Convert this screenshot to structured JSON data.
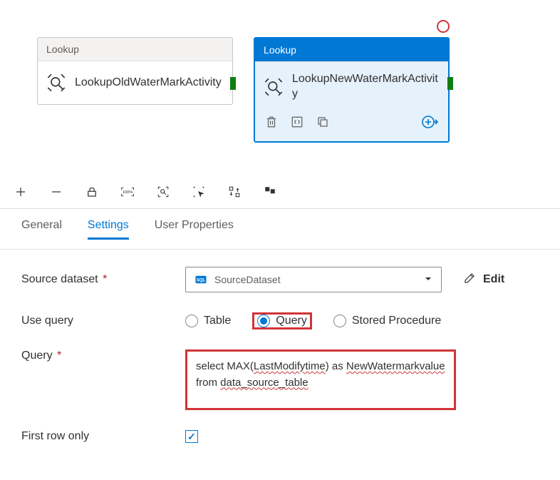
{
  "canvas": {
    "activities": [
      {
        "type_label": "Lookup",
        "name": "LookupOldWaterMarkActivity",
        "selected": false
      },
      {
        "type_label": "Lookup",
        "name": "LookupNewWaterMarkActivity",
        "selected": true
      }
    ]
  },
  "tabs": {
    "general": "General",
    "settings": "Settings",
    "user_properties": "User Properties"
  },
  "settings": {
    "source_dataset_label": "Source dataset",
    "source_dataset_value": "SourceDataset",
    "edit_label": "Edit",
    "use_query_label": "Use query",
    "use_query_options": {
      "table": "Table",
      "query": "Query",
      "stored_procedure": "Stored Procedure"
    },
    "query_label": "Query",
    "query_value": "select MAX(LastModifytime) as NewWatermarkvalue from data_source_table",
    "first_row_only_label": "First row only",
    "first_row_only_checked": true
  }
}
